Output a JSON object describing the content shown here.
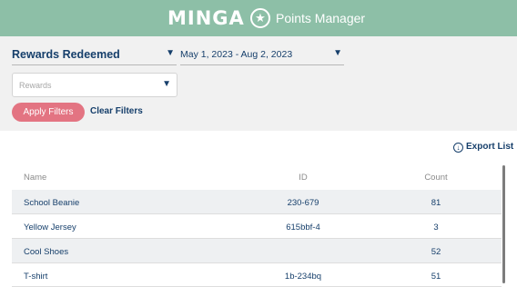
{
  "header": {
    "logo_text": "MINGA",
    "app_title": "Points Manager",
    "icon": "star-icon"
  },
  "filters": {
    "type_dropdown": {
      "value": "Rewards Redeemed",
      "icon": "chevron-down-icon"
    },
    "date_dropdown": {
      "value": "May 1, 2023 - Aug 2, 2023",
      "icon": "chevron-down-icon"
    },
    "rewards_select": {
      "placeholder": "Rewards",
      "icon": "chevron-down-icon"
    },
    "apply_label": "Apply Filters",
    "clear_label": "Clear Filters"
  },
  "actions": {
    "export_label": "Export List",
    "export_icon": "download-icon"
  },
  "table": {
    "columns": [
      "Name",
      "ID",
      "Count"
    ],
    "rows": [
      {
        "name": "School Beanie",
        "id": "230-679",
        "count": "81"
      },
      {
        "name": "Yellow Jersey",
        "id": "615bbf-4",
        "count": "3"
      },
      {
        "name": "Cool Shoes",
        "id": "",
        "count": "52"
      },
      {
        "name": "T-shirt",
        "id": "1b-234bq",
        "count": "51"
      }
    ]
  },
  "colors": {
    "header_bg": "#8dbfa7",
    "filter_bg": "#f1f1f1",
    "primary_text": "#163f6b",
    "apply_button": "#e37482"
  }
}
